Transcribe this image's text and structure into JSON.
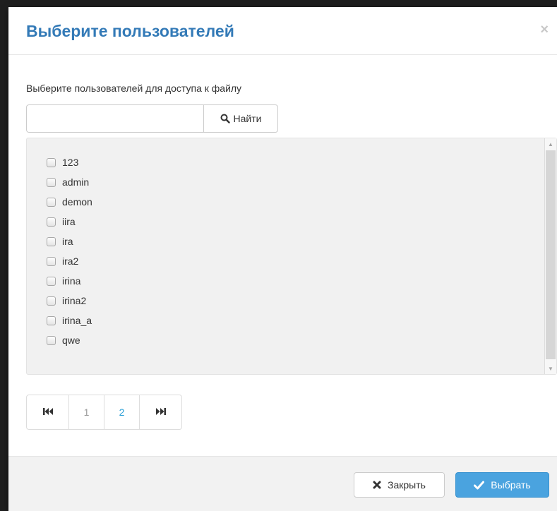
{
  "dialog": {
    "title": "Выберите пользователей",
    "close_glyph": "×"
  },
  "body": {
    "description": "Выберите пользователей для доступа к файлу",
    "search": {
      "value": "",
      "placeholder": "",
      "button_label": "Найти",
      "button_icon": "search-icon"
    },
    "users": [
      {
        "name": "123",
        "checked": false
      },
      {
        "name": "admin",
        "checked": false
      },
      {
        "name": "demon",
        "checked": false
      },
      {
        "name": "iira",
        "checked": false
      },
      {
        "name": "ira",
        "checked": false
      },
      {
        "name": "ira2",
        "checked": false
      },
      {
        "name": "irina",
        "checked": false
      },
      {
        "name": "irina2",
        "checked": false
      },
      {
        "name": "irina_a",
        "checked": false
      },
      {
        "name": "qwe",
        "checked": false
      }
    ]
  },
  "pagination": {
    "first_icon": "first-page-icon",
    "last_icon": "last-page-icon",
    "pages": [
      "1",
      "2"
    ],
    "current_page": "2"
  },
  "footer": {
    "close_label": "Закрыть",
    "close_icon": "close-icon",
    "select_label": "Выбрать",
    "select_icon": "check-icon"
  },
  "colors": {
    "title": "#337ab7",
    "primary_button": "#4aa3df",
    "active_page": "#2a9fd6"
  }
}
